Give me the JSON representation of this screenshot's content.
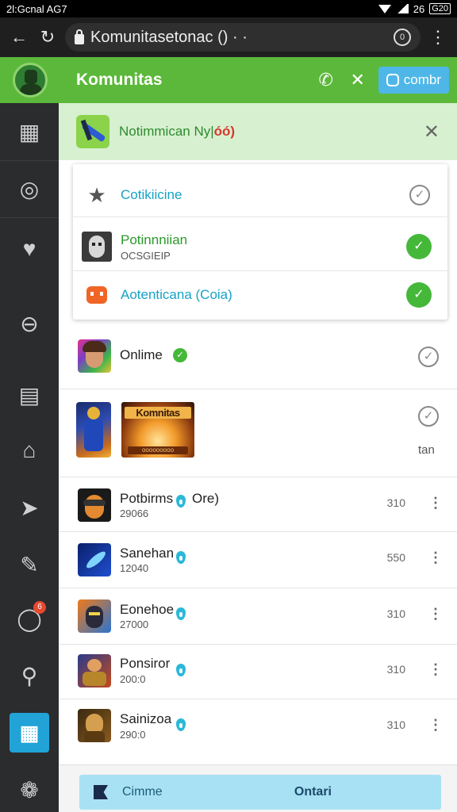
{
  "statusbar": {
    "left": "2l:Gcnal AG7",
    "right": "26",
    "battery": "G20"
  },
  "browser": {
    "url": "Komunitasetonac () · ·",
    "tabs_count": "0"
  },
  "header": {
    "title": "Komunitas",
    "button_label": "combr"
  },
  "sidebar": {
    "badge": "6"
  },
  "banner": {
    "text": "Notimmican Ny|",
    "highlight": "óó)"
  },
  "card": {
    "rows": [
      {
        "title": "Cotikiicine"
      },
      {
        "title": "Potinnniian",
        "subtitle": "OCSGIEIP"
      },
      {
        "title": "Aotenticana (Coia)"
      }
    ]
  },
  "feed": {
    "online": {
      "label": "Onlime"
    },
    "banner_item": {
      "title": "Komnitas",
      "caption": "tan",
      "strip": "ooooooooo"
    },
    "rows": [
      {
        "name": "Potbirms",
        "tag": "Ore)",
        "sub": "29066",
        "num": "310"
      },
      {
        "name": "Sanehan",
        "sub": "12040",
        "num": "550"
      },
      {
        "name": "Eonehoe",
        "sub": "27000",
        "num": "310"
      },
      {
        "name": "Ponsiror",
        "sub": "200:0",
        "num": "310"
      },
      {
        "name": "Sainizoa",
        "sub": "290:0",
        "num": "310"
      }
    ]
  },
  "bottom": {
    "left_label": "Cimme",
    "right_label": "Ontari"
  }
}
